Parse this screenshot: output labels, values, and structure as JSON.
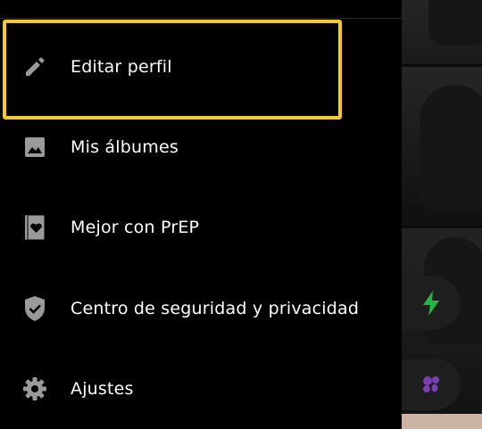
{
  "drawer": {
    "items": [
      {
        "label": "Editar perfil",
        "icon": "pencil-icon"
      },
      {
        "label": "Mis álbumes",
        "icon": "image-icon"
      },
      {
        "label": "Mejor con PrEP",
        "icon": "heart-card-icon"
      },
      {
        "label": "Centro de seguridad y privacidad",
        "icon": "shield-check-icon"
      },
      {
        "label": "Ajustes",
        "icon": "gear-icon"
      }
    ],
    "highlight_color": "#f8c91f"
  },
  "colors": {
    "icon": "#9a9a9a",
    "text": "#ffffff",
    "bolt": "#1fb845",
    "drop": "#7a3fb5"
  },
  "background_actions": {
    "icons": [
      "lightning-bolt-icon",
      "purple-drops-icon"
    ]
  }
}
